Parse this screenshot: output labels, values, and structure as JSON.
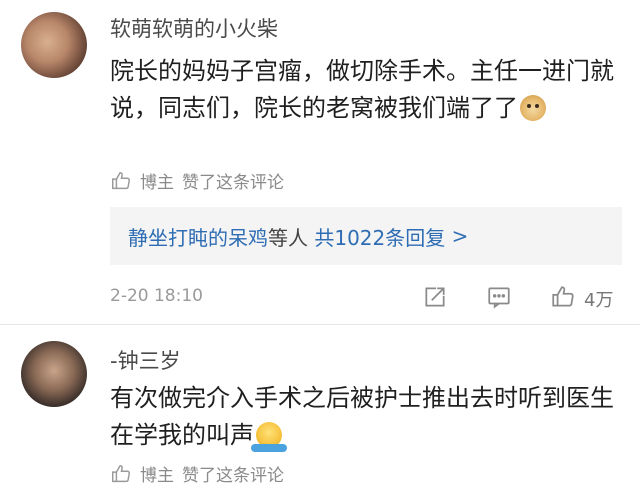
{
  "comments": [
    {
      "username": "软萌软萌的小火柴",
      "text": "院长的妈妈子宫瘤，做切除手术。主任一进门就说，同志们，院长的老窝被我们端了了",
      "emoji": "doge-emoji",
      "liked_prefix": "博主",
      "liked_suffix": "赞了这条评论",
      "replies": {
        "name": "静坐打盹的呆鸡",
        "mid": "等人",
        "total": "共1022条回复",
        "arrow": ">"
      },
      "timestamp": "2-20 18:10",
      "like_count": "4万"
    },
    {
      "username": "-钟三岁",
      "text": "有次做完介入手术之后被护士推出去时听到医生在学我的叫声",
      "emoji": "shrug-emoji",
      "liked_prefix": "博主",
      "liked_suffix": "赞了这条评论"
    }
  ],
  "icons": {
    "like": "thumbs-up-icon",
    "share": "share-icon",
    "comment": "comment-icon"
  },
  "colors": {
    "link_blue": "#2e6db4",
    "muted_gray": "#8a8a8a",
    "reply_bg": "#f4f4f4"
  }
}
